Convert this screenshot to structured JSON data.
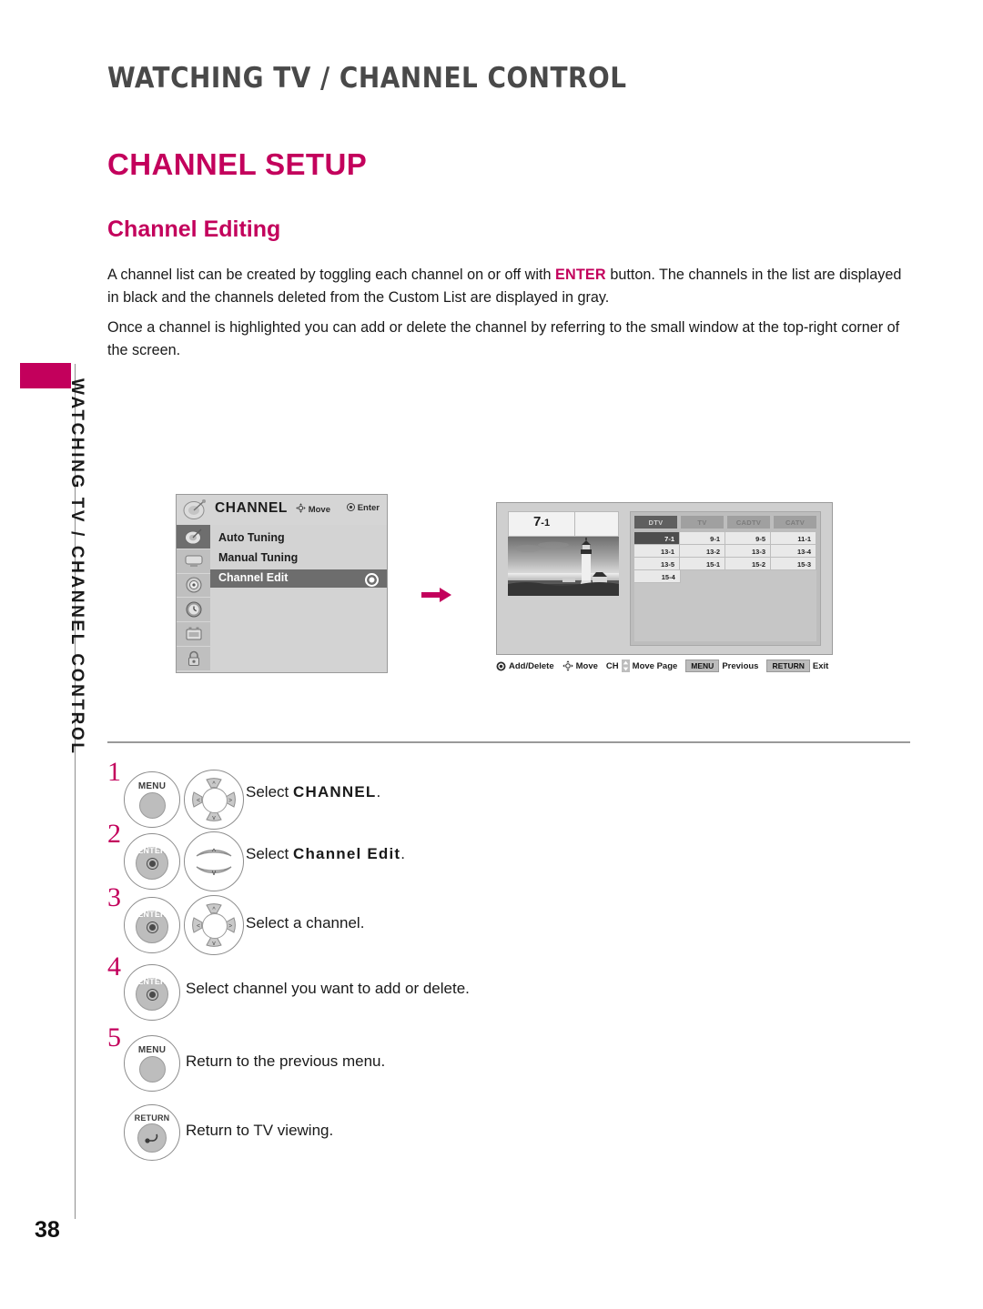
{
  "page": {
    "running_head": "WATCHING TV / CHANNEL CONTROL",
    "heading1": "CHANNEL SETUP",
    "heading2": "Channel Editing",
    "side_tab_label": "WATCHING TV / CHANNEL CONTROL",
    "page_number": "38",
    "accent_color": "#c3005c"
  },
  "body": {
    "para1_a": "A channel list can be created by toggling each channel on or off with ",
    "para1_enter": "ENTER",
    "para1_b": " button. The channels in the list are displayed in black and the channels deleted from the Custom List are displayed in gray.",
    "para2": "Once a channel is highlighted you can add or delete the channel by referring to the small window at the top-right corner of the screen."
  },
  "osd_left": {
    "title": "CHANNEL",
    "hint_move": "Move",
    "hint_enter": "Enter",
    "rail_icons": [
      "satellite-dish-icon",
      "picture-icon",
      "audio-icon",
      "time-icon",
      "option-icon",
      "lock-icon"
    ],
    "items": [
      {
        "label": "Auto Tuning",
        "selected": false
      },
      {
        "label": "Manual Tuning",
        "selected": false
      },
      {
        "label": "Channel Edit",
        "selected": true
      }
    ]
  },
  "osd_right": {
    "preview_channel": "7",
    "preview_channel_sub": "-1",
    "tabs": [
      {
        "label": "DTV",
        "selected": true
      },
      {
        "label": "TV",
        "selected": false
      },
      {
        "label": "CADTV",
        "selected": false
      },
      {
        "label": "CATV",
        "selected": false
      }
    ],
    "grid": [
      [
        {
          "label": "7-1",
          "selected": true
        },
        {
          "label": "9-1",
          "selected": false
        },
        {
          "label": "9-5",
          "selected": false
        },
        {
          "label": "11-1",
          "selected": false
        }
      ],
      [
        {
          "label": "13-1",
          "selected": false
        },
        {
          "label": "13-2",
          "selected": false
        },
        {
          "label": "13-3",
          "selected": false
        },
        {
          "label": "13-4",
          "selected": false
        }
      ],
      [
        {
          "label": "13-5",
          "selected": false
        },
        {
          "label": "15-1",
          "selected": false
        },
        {
          "label": "15-2",
          "selected": false
        },
        {
          "label": "15-3",
          "selected": false
        }
      ],
      [
        {
          "label": "15-4",
          "selected": false
        },
        {
          "label": "",
          "selected": false
        },
        {
          "label": "",
          "selected": false
        },
        {
          "label": "",
          "selected": false
        }
      ]
    ],
    "bottom_bar": {
      "add_delete": "Add/Delete",
      "move": "Move",
      "ch": "CH",
      "move_page": "Move Page",
      "menu_key": "MENU",
      "previous": "Previous",
      "return_key": "RETURN",
      "exit": "Exit"
    }
  },
  "steps": [
    {
      "num": "1",
      "button": "MENU",
      "pad": "dpad",
      "text_a": "Select ",
      "text_b": "CHANNEL",
      "text_c": "."
    },
    {
      "num": "2",
      "button": "ENTER",
      "pad": "updown",
      "text_a": "Select ",
      "text_b": "Channel Edit",
      "text_c": "."
    },
    {
      "num": "3",
      "button": "ENTER",
      "pad": "dpad",
      "text_a": "Select a channel.",
      "text_b": "",
      "text_c": ""
    },
    {
      "num": "4",
      "button": "ENTER",
      "pad": "none",
      "text_a": "Select channel you want to add or delete.",
      "text_b": "",
      "text_c": ""
    },
    {
      "num": "5",
      "button": "MENU",
      "pad": "none",
      "text_a": "Return to the previous menu.",
      "text_b": "",
      "text_c": ""
    },
    {
      "num": "",
      "button": "RETURN",
      "pad": "none",
      "text_a": "Return to TV viewing.",
      "text_b": "",
      "text_c": ""
    }
  ]
}
